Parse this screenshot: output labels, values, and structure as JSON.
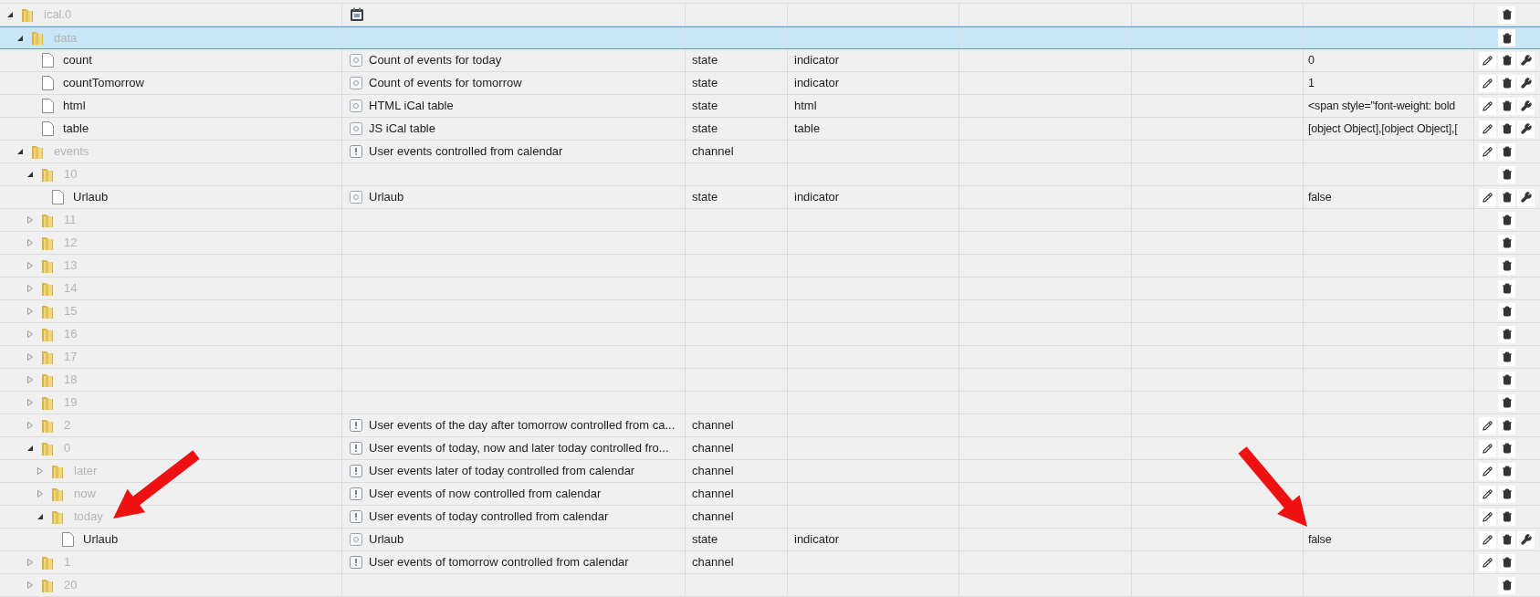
{
  "tree": [
    {
      "name": "ical.0",
      "kind": "folder",
      "expanded": true,
      "selected": false,
      "description": {
        "kind": "calendar"
      },
      "actions": [
        {
          "kind": "delete"
        }
      ],
      "children": [
        {
          "name": "data",
          "kind": "folder",
          "expanded": true,
          "selected": true,
          "actions": [
            {
              "kind": "delete"
            }
          ],
          "children": [
            {
              "name": "count",
              "kind": "file",
              "selected": false,
              "description": {
                "kind": "state",
                "text": "Count of events for today"
              },
              "type": "state",
              "role": "indicator",
              "value": "0",
              "actions": [
                {
                  "kind": "edit"
                },
                {
                  "kind": "delete"
                },
                {
                  "kind": "settings"
                }
              ]
            },
            {
              "name": "countTomorrow",
              "kind": "file",
              "selected": false,
              "description": {
                "kind": "state",
                "text": "Count of events for tomorrow"
              },
              "type": "state",
              "role": "indicator",
              "value": "1",
              "actions": [
                {
                  "kind": "edit"
                },
                {
                  "kind": "delete"
                },
                {
                  "kind": "settings"
                }
              ]
            },
            {
              "name": "html",
              "kind": "file",
              "selected": false,
              "description": {
                "kind": "state",
                "text": "HTML iCal table"
              },
              "type": "state",
              "role": "html",
              "value": "<span style=\"font-weight: bold",
              "actions": [
                {
                  "kind": "edit"
                },
                {
                  "kind": "delete"
                },
                {
                  "kind": "settings"
                }
              ]
            },
            {
              "name": "table",
              "kind": "file",
              "selected": false,
              "description": {
                "kind": "state",
                "text": "JS iCal table"
              },
              "type": "state",
              "role": "table",
              "value": "[object Object],[object Object],[",
              "actions": [
                {
                  "kind": "edit"
                },
                {
                  "kind": "delete"
                },
                {
                  "kind": "settings"
                }
              ]
            }
          ]
        },
        {
          "name": "events",
          "kind": "folder",
          "expanded": true,
          "selected": false,
          "description": {
            "kind": "channel",
            "text": "User events controlled from calendar"
          },
          "type": "channel",
          "actions": [
            {
              "kind": "edit"
            },
            {
              "kind": "delete"
            }
          ],
          "children": [
            {
              "name": "10",
              "kind": "folder",
              "expanded": true,
              "selected": false,
              "actions": [
                {
                  "kind": "delete"
                }
              ],
              "children": [
                {
                  "name": "Urlaub",
                  "kind": "file",
                  "selected": false,
                  "description": {
                    "kind": "state",
                    "text": "Urlaub"
                  },
                  "type": "state",
                  "role": "indicator",
                  "value": "false",
                  "actions": [
                    {
                      "kind": "edit"
                    },
                    {
                      "kind": "delete"
                    },
                    {
                      "kind": "settings"
                    }
                  ]
                }
              ]
            },
            {
              "name": "11",
              "kind": "folder",
              "expanded": false,
              "selected": false,
              "actions": [
                {
                  "kind": "delete"
                }
              ]
            },
            {
              "name": "12",
              "kind": "folder",
              "expanded": false,
              "selected": false,
              "actions": [
                {
                  "kind": "delete"
                }
              ]
            },
            {
              "name": "13",
              "kind": "folder",
              "expanded": false,
              "selected": false,
              "actions": [
                {
                  "kind": "delete"
                }
              ]
            },
            {
              "name": "14",
              "kind": "folder",
              "expanded": false,
              "selected": false,
              "actions": [
                {
                  "kind": "delete"
                }
              ]
            },
            {
              "name": "15",
              "kind": "folder",
              "expanded": false,
              "selected": false,
              "actions": [
                {
                  "kind": "delete"
                }
              ]
            },
            {
              "name": "16",
              "kind": "folder",
              "expanded": false,
              "selected": false,
              "actions": [
                {
                  "kind": "delete"
                }
              ]
            },
            {
              "name": "17",
              "kind": "folder",
              "expanded": false,
              "selected": false,
              "actions": [
                {
                  "kind": "delete"
                }
              ]
            },
            {
              "name": "18",
              "kind": "folder",
              "expanded": false,
              "selected": false,
              "actions": [
                {
                  "kind": "delete"
                }
              ]
            },
            {
              "name": "19",
              "kind": "folder",
              "expanded": false,
              "selected": false,
              "actions": [
                {
                  "kind": "delete"
                }
              ]
            },
            {
              "name": "2",
              "kind": "folder",
              "expanded": false,
              "selected": false,
              "description": {
                "kind": "channel",
                "text": "User events of the day after tomorrow controlled from ca..."
              },
              "type": "channel",
              "actions": [
                {
                  "kind": "edit"
                },
                {
                  "kind": "delete"
                }
              ]
            },
            {
              "name": "0",
              "kind": "folder",
              "expanded": true,
              "selected": false,
              "description": {
                "kind": "channel",
                "text": "User events of today, now and later today controlled fro..."
              },
              "type": "channel",
              "actions": [
                {
                  "kind": "edit"
                },
                {
                  "kind": "delete"
                }
              ],
              "children": [
                {
                  "name": "later",
                  "kind": "folder",
                  "expanded": false,
                  "selected": false,
                  "description": {
                    "kind": "channel",
                    "text": "User events later of today controlled from calendar"
                  },
                  "type": "channel",
                  "actions": [
                    {
                      "kind": "edit"
                    },
                    {
                      "kind": "delete"
                    }
                  ]
                },
                {
                  "name": "now",
                  "kind": "folder",
                  "expanded": false,
                  "selected": false,
                  "description": {
                    "kind": "channel",
                    "text": "User events of now controlled from calendar"
                  },
                  "type": "channel",
                  "actions": [
                    {
                      "kind": "edit"
                    },
                    {
                      "kind": "delete"
                    }
                  ]
                },
                {
                  "name": "today",
                  "kind": "folder",
                  "expanded": true,
                  "selected": false,
                  "description": {
                    "kind": "channel",
                    "text": "User events of today controlled from calendar"
                  },
                  "type": "channel",
                  "actions": [
                    {
                      "kind": "edit"
                    },
                    {
                      "kind": "delete"
                    }
                  ],
                  "children": [
                    {
                      "name": "Urlaub",
                      "kind": "file",
                      "selected": false,
                      "description": {
                        "kind": "state",
                        "text": "Urlaub"
                      },
                      "type": "state",
                      "role": "indicator",
                      "value": "false",
                      "actions": [
                        {
                          "kind": "edit"
                        },
                        {
                          "kind": "delete"
                        },
                        {
                          "kind": "settings"
                        }
                      ]
                    }
                  ]
                }
              ]
            },
            {
              "name": "1",
              "kind": "folder",
              "expanded": false,
              "selected": false,
              "description": {
                "kind": "channel",
                "text": "User events of tomorrow controlled from calendar"
              },
              "type": "channel",
              "actions": [
                {
                  "kind": "edit"
                },
                {
                  "kind": "delete"
                }
              ]
            },
            {
              "name": "20",
              "kind": "folder",
              "expanded": false,
              "selected": false,
              "actions": [
                {
                  "kind": "delete"
                }
              ]
            }
          ]
        }
      ]
    }
  ],
  "annotations": [
    {
      "kind": "arrow"
    },
    {
      "kind": "arrow"
    }
  ]
}
